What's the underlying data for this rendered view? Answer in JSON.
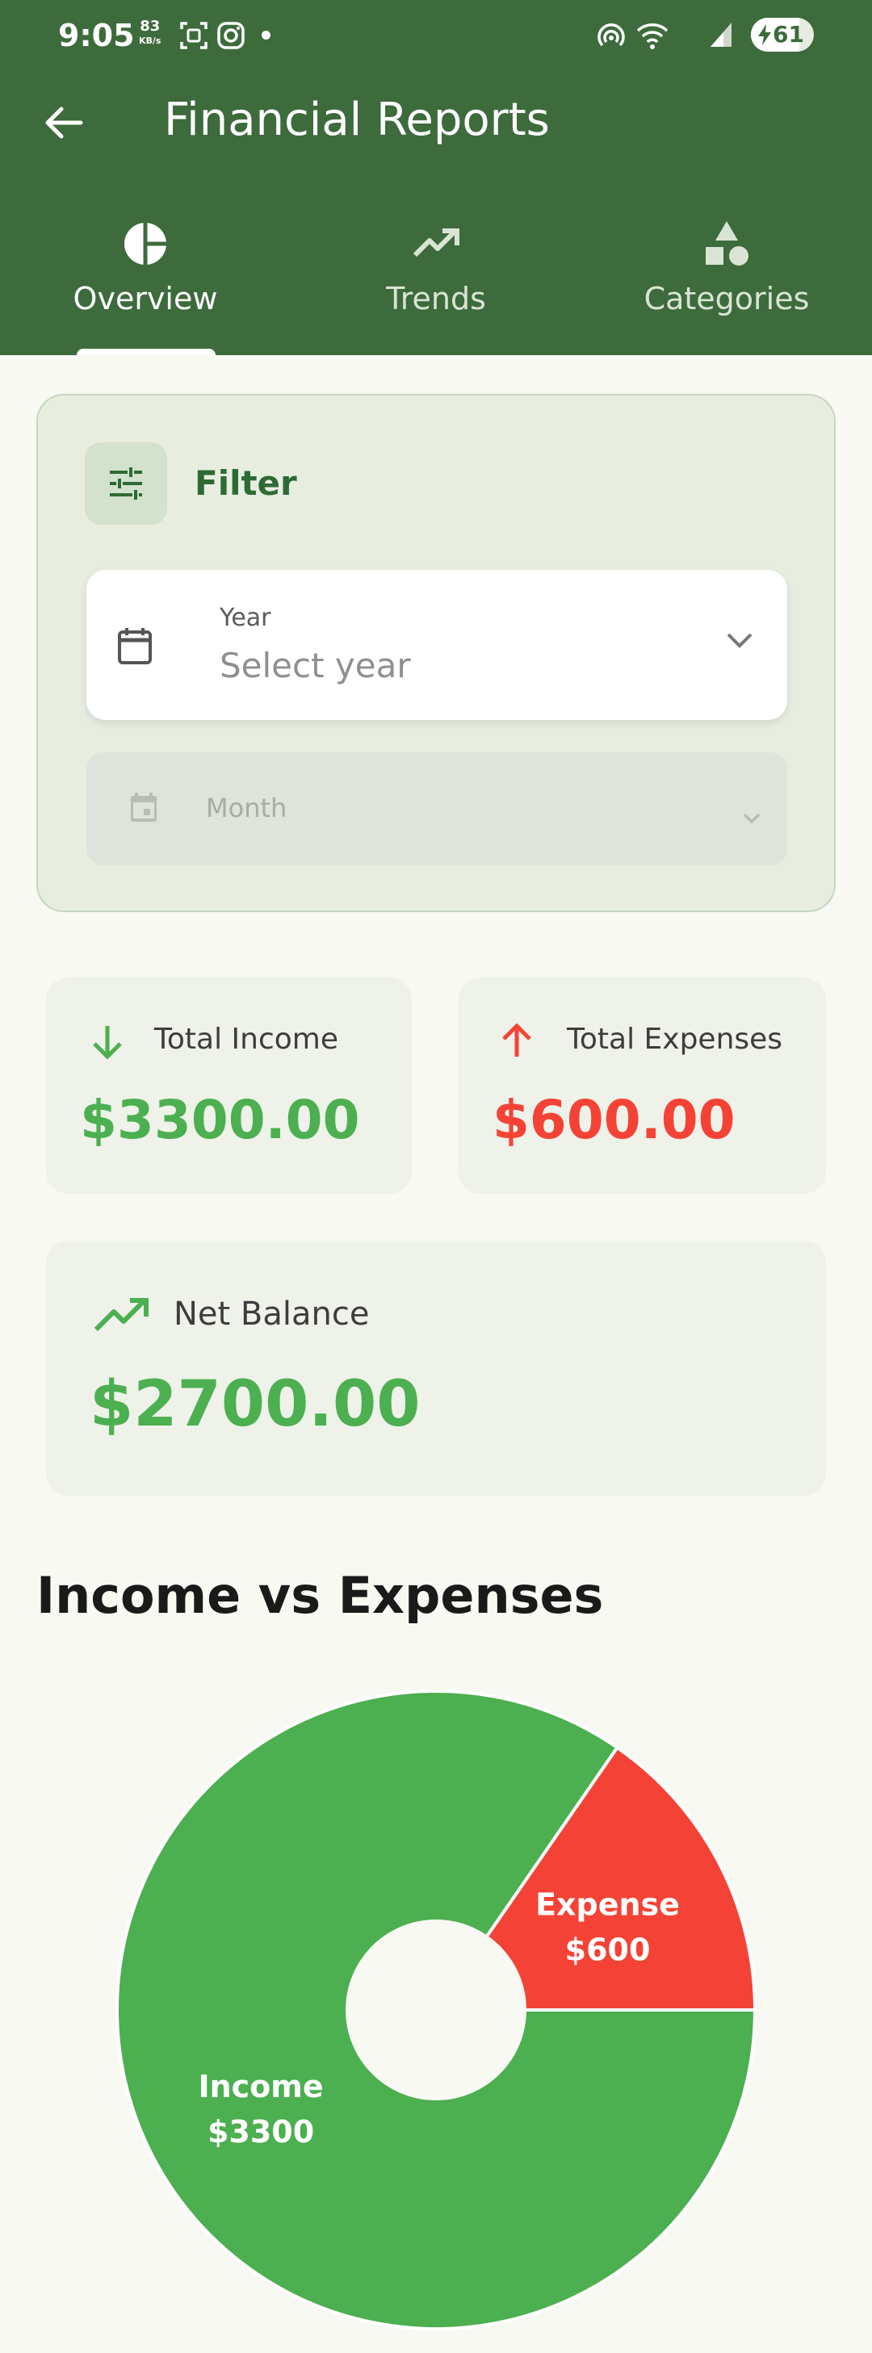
{
  "status_bar": {
    "time": "9:05",
    "speed_value": "83",
    "speed_unit": "KB/s",
    "battery": "61"
  },
  "header": {
    "title": "Financial Reports"
  },
  "tabs": [
    {
      "label": "Overview",
      "icon": "pie-chart-icon",
      "active": true
    },
    {
      "label": "Trends",
      "icon": "trending-up-icon",
      "active": false
    },
    {
      "label": "Categories",
      "icon": "category-icon",
      "active": false
    }
  ],
  "filter": {
    "title": "Filter",
    "year_label": "Year",
    "year_placeholder": "Select year",
    "month_label": "Month"
  },
  "summary": {
    "income_label": "Total Income",
    "income_value": "$3300.00",
    "expense_label": "Total Expenses",
    "expense_value": "$600.00",
    "net_label": "Net Balance",
    "net_value": "$2700.00"
  },
  "colors": {
    "primary": "#3d6b3c",
    "income": "#4caf50",
    "expense": "#f44336"
  },
  "section_title": "Income vs Expenses",
  "chart_data": {
    "type": "pie",
    "title": "",
    "slices": [
      {
        "name": "Expense",
        "label": "Expense",
        "value_label": "$600",
        "value": 600,
        "color": "#f44336"
      },
      {
        "name": "Income",
        "label": "Income",
        "value_label": "$3300",
        "value": 3300,
        "color": "#4caf50"
      }
    ]
  }
}
